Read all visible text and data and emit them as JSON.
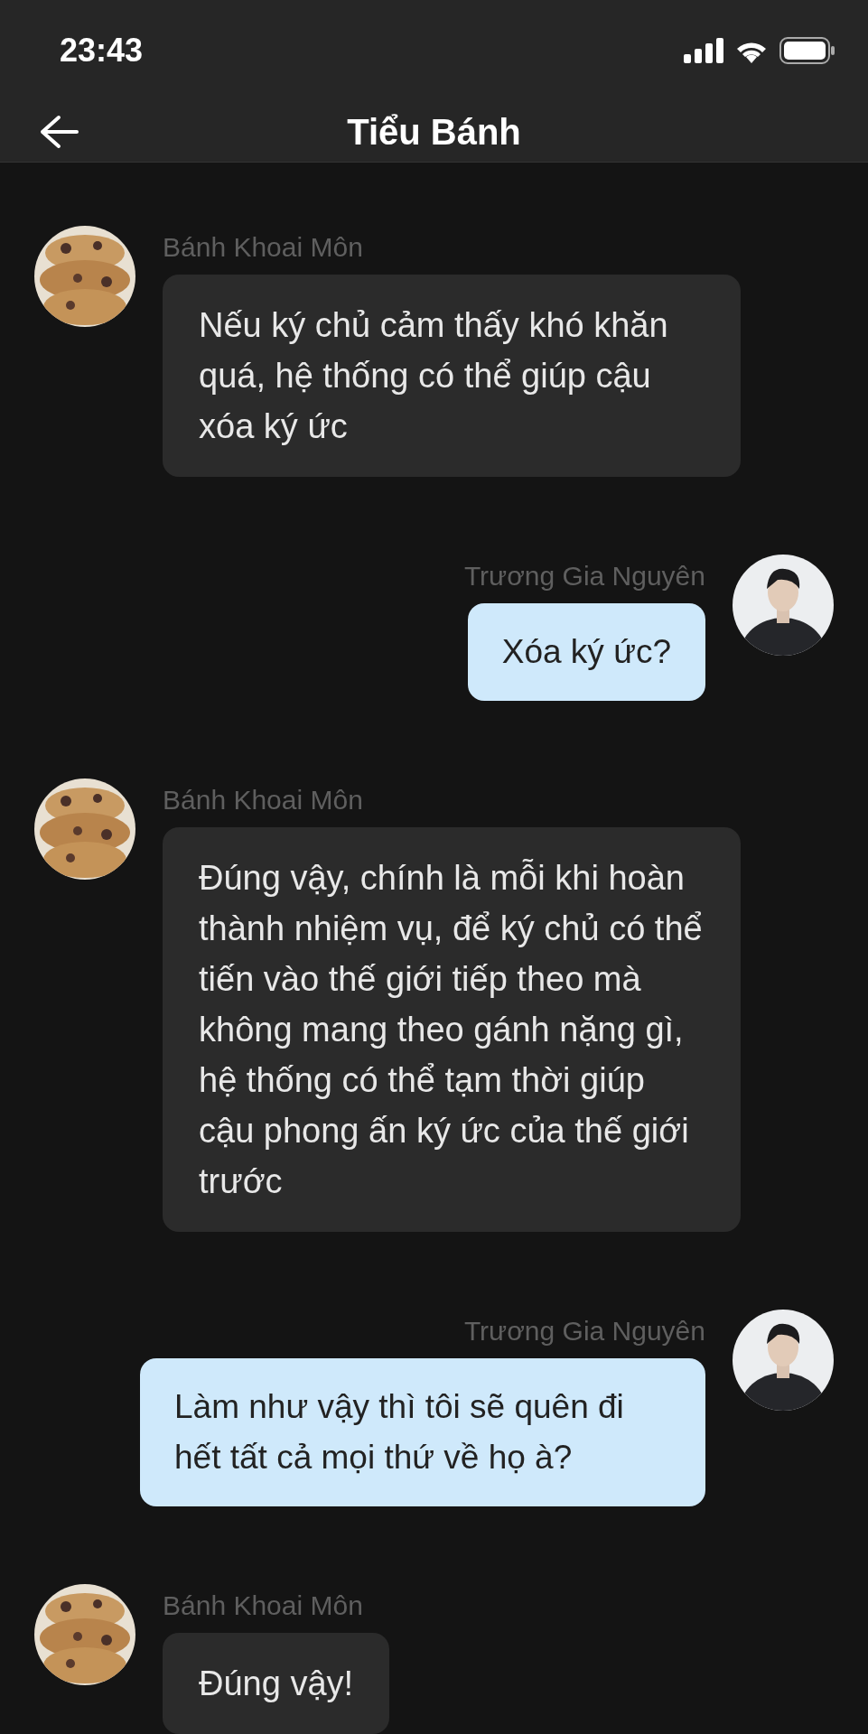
{
  "status_bar": {
    "time": "23:43"
  },
  "header": {
    "title": "Tiểu Bánh"
  },
  "messages": [
    {
      "kind": "left",
      "sender": "Bánh Khoai Môn",
      "text": "Nếu ký chủ cảm thấy khó khăn quá, hệ thống có thể giúp cậu xóa ký ức"
    },
    {
      "kind": "right",
      "sender": "Trương Gia Nguyên",
      "text": "Xóa ký ức?"
    },
    {
      "kind": "left",
      "sender": "Bánh Khoai Môn",
      "text": "Đúng vậy, chính là mỗi khi hoàn thành nhiệm vụ, để ký chủ có thể tiến vào thế giới tiếp theo mà không mang theo gánh nặng gì, hệ thống có thể tạm thời giúp cậu phong ấn ký ức của thế giới trước"
    },
    {
      "kind": "right",
      "sender": "Trương Gia Nguyên",
      "text": "Làm như vậy thì tôi sẽ quên đi hết tất cả mọi thứ về họ à?"
    },
    {
      "kind": "left",
      "sender": "Bánh Khoai Môn",
      "text": "Đúng vậy!"
    }
  ]
}
